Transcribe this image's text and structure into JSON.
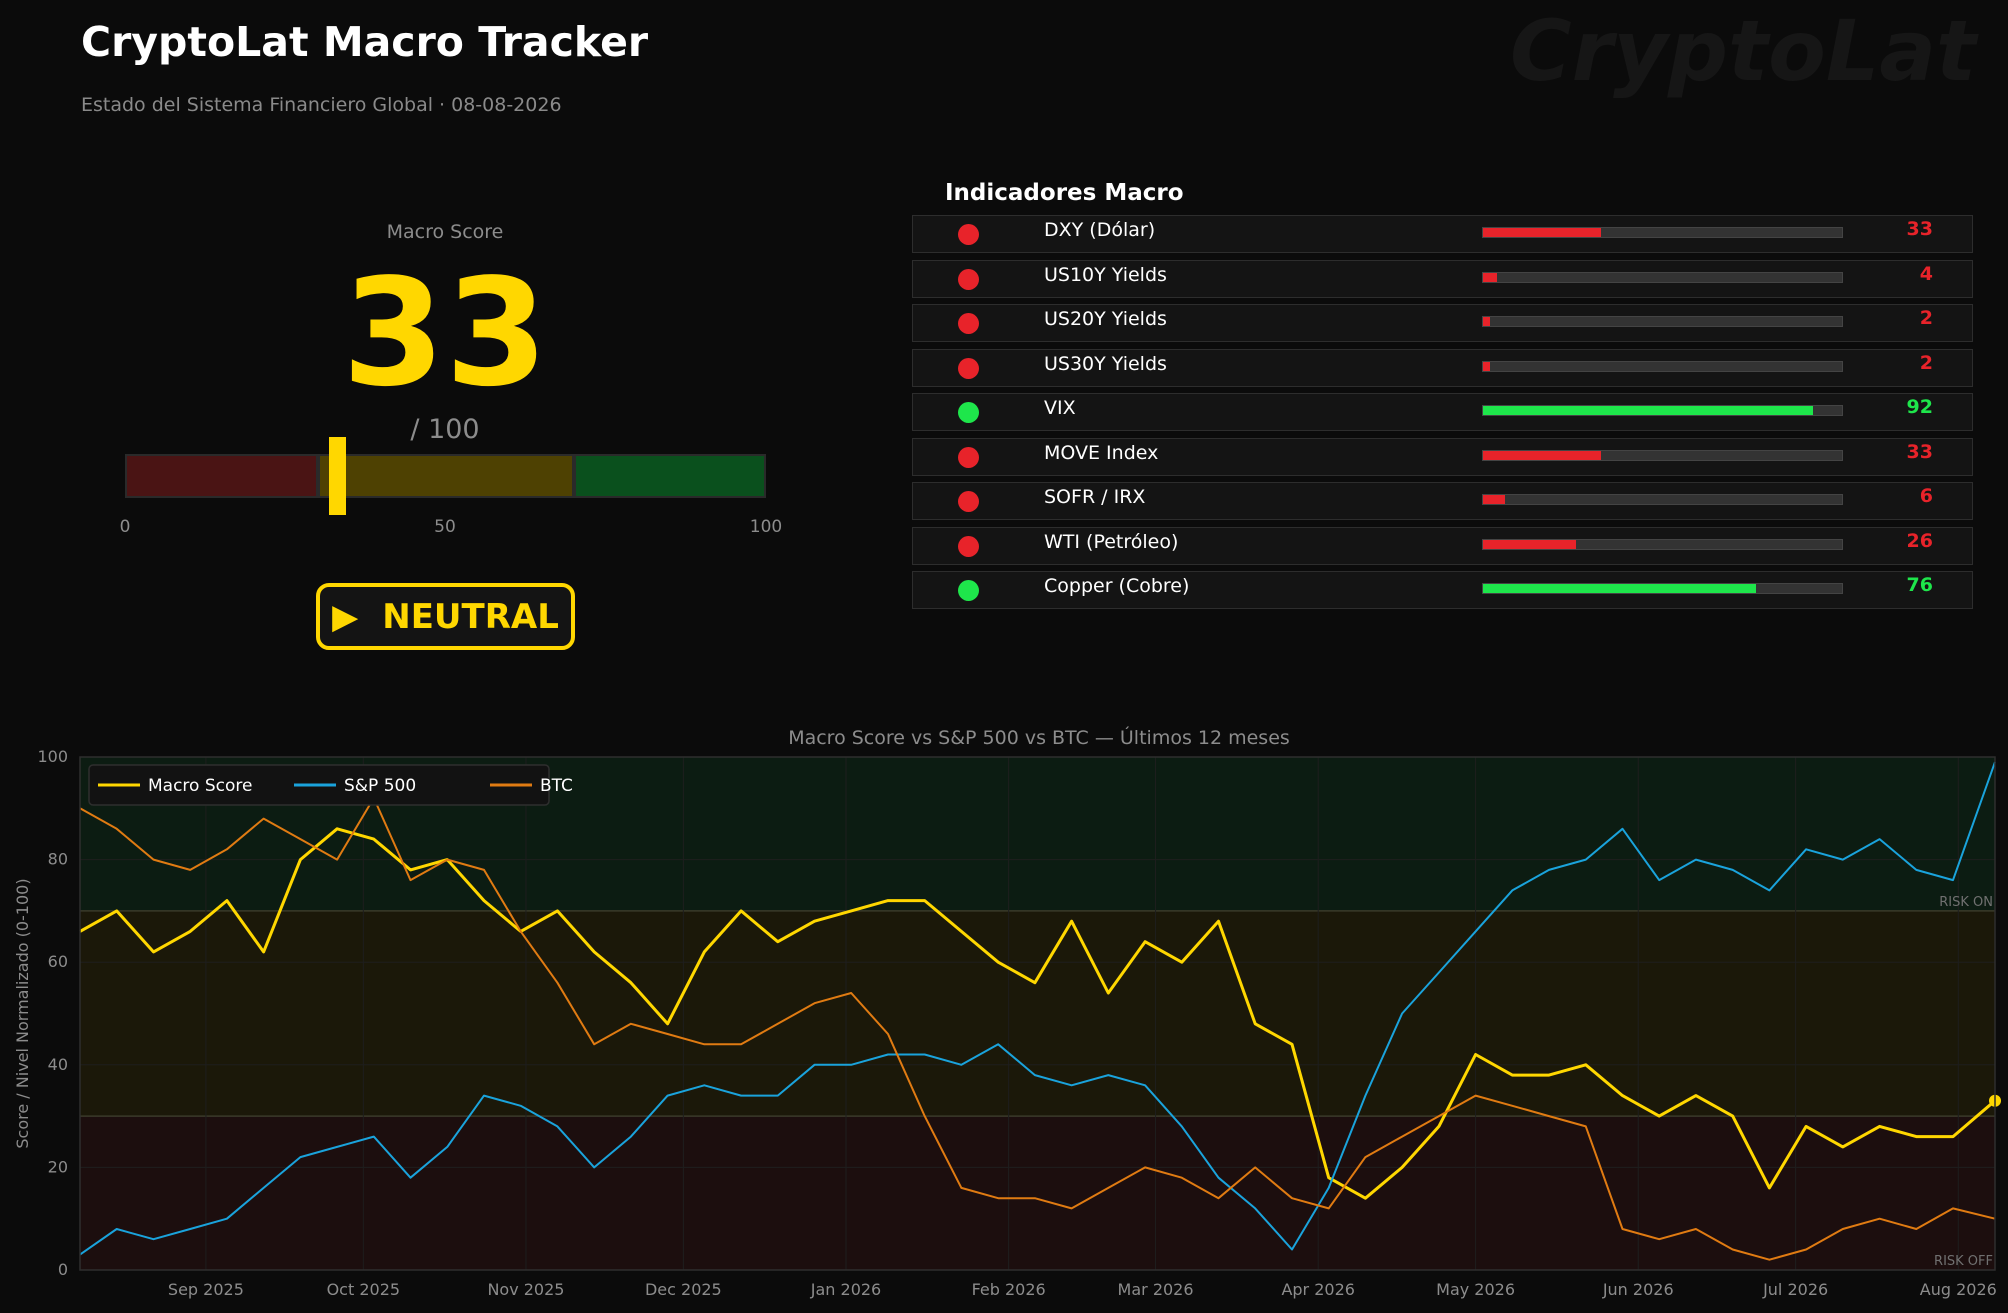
{
  "header": {
    "title": "CryptoLat Macro Tracker",
    "subtitle": "Estado del Sistema Financiero Global  ·  08-08-2026",
    "watermark": "CryptoLat"
  },
  "score": {
    "label": "Macro Score",
    "value": "33",
    "value_number": 33,
    "max_label": "/ 100",
    "ticks": [
      "0",
      "50",
      "100"
    ],
    "zones": [
      [
        0,
        30
      ],
      [
        30,
        70
      ],
      [
        70,
        100
      ]
    ],
    "status_icon": "play-icon",
    "status_glyph": "▶",
    "status": "NEUTRAL"
  },
  "colors": {
    "accent": "#ffd700",
    "negative": "#e8232a",
    "positive": "#1ee64b",
    "sp500": "#1aa3dc",
    "btc": "#e07b12",
    "macro": "#ffd700"
  },
  "indicators": {
    "title": "Indicadores Macro",
    "items": [
      {
        "name": "DXY (Dólar)",
        "value": "33",
        "level": 33,
        "status": "negative"
      },
      {
        "name": "US10Y Yields",
        "value": "4",
        "level": 4,
        "status": "negative"
      },
      {
        "name": "US20Y Yields",
        "value": "2",
        "level": 2,
        "status": "negative"
      },
      {
        "name": "US30Y Yields",
        "value": "2",
        "level": 2,
        "status": "negative"
      },
      {
        "name": "VIX",
        "value": "92",
        "level": 92,
        "status": "positive"
      },
      {
        "name": "MOVE Index",
        "value": "33",
        "level": 33,
        "status": "negative"
      },
      {
        "name": "SOFR / IRX",
        "value": "6",
        "level": 6,
        "status": "negative"
      },
      {
        "name": "WTI (Petróleo)",
        "value": "26",
        "level": 26,
        "status": "negative"
      },
      {
        "name": "Copper (Cobre)",
        "value": "76",
        "level": 76,
        "status": "positive"
      }
    ]
  },
  "chart_data": {
    "type": "line",
    "title": "Macro Score vs S&P 500 vs BTC — Últimos 12 meses",
    "ylabel": "Score / Nivel Normalizado (0-100)",
    "xlabel": "",
    "ylim": [
      0,
      100
    ],
    "yticks": [
      "0",
      "20",
      "40",
      "60",
      "80",
      "100"
    ],
    "xlim": [
      "2025-08-08",
      "2026-08-08"
    ],
    "xticks": [
      {
        "date": "2025-09-01",
        "label": "Sep 2025"
      },
      {
        "date": "2025-10-01",
        "label": "Oct 2025"
      },
      {
        "date": "2025-11-01",
        "label": "Nov 2025"
      },
      {
        "date": "2025-12-01",
        "label": "Dec 2025"
      },
      {
        "date": "2026-01-01",
        "label": "Jan 2026"
      },
      {
        "date": "2026-02-01",
        "label": "Feb 2026"
      },
      {
        "date": "2026-03-01",
        "label": "Mar 2026"
      },
      {
        "date": "2026-04-01",
        "label": "Apr 2026"
      },
      {
        "date": "2026-05-01",
        "label": "May 2026"
      },
      {
        "date": "2026-06-01",
        "label": "Jun 2026"
      },
      {
        "date": "2026-07-01",
        "label": "Jul 2026"
      },
      {
        "date": "2026-08-01",
        "label": "Aug 2026"
      }
    ],
    "zones": [
      {
        "from": 70,
        "to": 100,
        "label": "RISK ON"
      },
      {
        "from": 30,
        "to": 70,
        "label": ""
      },
      {
        "from": 0,
        "to": 30,
        "label": "RISK OFF"
      }
    ],
    "legend_position": "top-left",
    "series": [
      {
        "name": "Macro Score",
        "color": "#ffd700",
        "x": [
          "2025-08-08",
          "2025-08-15",
          "2025-08-22",
          "2025-08-29",
          "2025-09-05",
          "2025-09-12",
          "2025-09-19",
          "2025-09-26",
          "2025-10-03",
          "2025-10-10",
          "2025-10-17",
          "2025-10-24",
          "2025-10-31",
          "2025-11-07",
          "2025-11-14",
          "2025-11-21",
          "2025-11-28",
          "2025-12-05",
          "2025-12-12",
          "2025-12-19",
          "2025-12-26",
          "2026-01-02",
          "2026-01-09",
          "2026-01-16",
          "2026-01-23",
          "2026-01-30",
          "2026-02-06",
          "2026-02-13",
          "2026-02-20",
          "2026-02-27",
          "2026-03-06",
          "2026-03-13",
          "2026-03-20",
          "2026-03-27",
          "2026-04-03",
          "2026-04-10",
          "2026-04-17",
          "2026-04-24",
          "2026-05-01",
          "2026-05-08",
          "2026-05-15",
          "2026-05-22",
          "2026-05-29",
          "2026-06-05",
          "2026-06-12",
          "2026-06-19",
          "2026-06-26",
          "2026-07-03",
          "2026-07-10",
          "2026-07-17",
          "2026-07-24",
          "2026-07-31",
          "2026-08-08"
        ],
        "y": [
          66,
          70,
          62,
          66,
          72,
          62,
          80,
          86,
          84,
          78,
          80,
          72,
          66,
          70,
          62,
          56,
          48,
          62,
          70,
          64,
          68,
          70,
          72,
          72,
          66,
          60,
          56,
          68,
          54,
          64,
          60,
          68,
          48,
          44,
          18,
          14,
          20,
          28,
          42,
          38,
          38,
          40,
          34,
          30,
          34,
          30,
          16,
          28,
          24,
          28,
          26,
          26,
          33
        ]
      },
      {
        "name": "S&P 500",
        "color": "#1aa3dc",
        "x": [
          "2025-08-08",
          "2025-08-15",
          "2025-08-22",
          "2025-08-29",
          "2025-09-05",
          "2025-09-12",
          "2025-09-19",
          "2025-09-26",
          "2025-10-03",
          "2025-10-10",
          "2025-10-17",
          "2025-10-24",
          "2025-10-31",
          "2025-11-07",
          "2025-11-14",
          "2025-11-21",
          "2025-11-28",
          "2025-12-05",
          "2025-12-12",
          "2025-12-19",
          "2025-12-26",
          "2026-01-02",
          "2026-01-09",
          "2026-01-16",
          "2026-01-23",
          "2026-01-30",
          "2026-02-06",
          "2026-02-13",
          "2026-02-20",
          "2026-02-27",
          "2026-03-06",
          "2026-03-13",
          "2026-03-20",
          "2026-03-27",
          "2026-04-03",
          "2026-04-10",
          "2026-04-17",
          "2026-04-24",
          "2026-05-01",
          "2026-05-08",
          "2026-05-15",
          "2026-05-22",
          "2026-05-29",
          "2026-06-05",
          "2026-06-12",
          "2026-06-19",
          "2026-06-26",
          "2026-07-03",
          "2026-07-10",
          "2026-07-17",
          "2026-07-24",
          "2026-07-31",
          "2026-08-08"
        ],
        "y": [
          3,
          8,
          6,
          8,
          10,
          16,
          22,
          24,
          26,
          18,
          24,
          34,
          32,
          28,
          20,
          26,
          34,
          36,
          34,
          34,
          40,
          40,
          42,
          42,
          40,
          44,
          38,
          36,
          38,
          36,
          28,
          18,
          12,
          4,
          16,
          34,
          50,
          58,
          66,
          74,
          78,
          80,
          86,
          76,
          80,
          78,
          74,
          82,
          80,
          84,
          78,
          76,
          99
        ]
      },
      {
        "name": "BTC",
        "color": "#e07b12",
        "x": [
          "2025-08-08",
          "2025-08-15",
          "2025-08-22",
          "2025-08-29",
          "2025-09-05",
          "2025-09-12",
          "2025-09-19",
          "2025-09-26",
          "2025-10-03",
          "2025-10-10",
          "2025-10-17",
          "2025-10-24",
          "2025-10-31",
          "2025-11-07",
          "2025-11-14",
          "2025-11-21",
          "2025-11-28",
          "2025-12-05",
          "2025-12-12",
          "2025-12-19",
          "2025-12-26",
          "2026-01-02",
          "2026-01-09",
          "2026-01-16",
          "2026-01-23",
          "2026-01-30",
          "2026-02-06",
          "2026-02-13",
          "2026-02-20",
          "2026-02-27",
          "2026-03-06",
          "2026-03-13",
          "2026-03-20",
          "2026-03-27",
          "2026-04-03",
          "2026-04-10",
          "2026-04-17",
          "2026-04-24",
          "2026-05-01",
          "2026-05-08",
          "2026-05-15",
          "2026-05-22",
          "2026-05-29",
          "2026-06-05",
          "2026-06-12",
          "2026-06-19",
          "2026-06-26",
          "2026-07-03",
          "2026-07-10",
          "2026-07-17",
          "2026-07-24",
          "2026-07-31",
          "2026-08-08"
        ],
        "y": [
          90,
          86,
          80,
          78,
          82,
          88,
          84,
          80,
          92,
          76,
          80,
          78,
          66,
          56,
          44,
          48,
          46,
          44,
          44,
          48,
          52,
          54,
          46,
          30,
          16,
          14,
          14,
          12,
          16,
          20,
          18,
          14,
          20,
          14,
          12,
          22,
          26,
          30,
          34,
          32,
          30,
          28,
          8,
          6,
          8,
          4,
          2,
          4,
          8,
          10,
          8,
          12,
          10
        ]
      }
    ]
  }
}
